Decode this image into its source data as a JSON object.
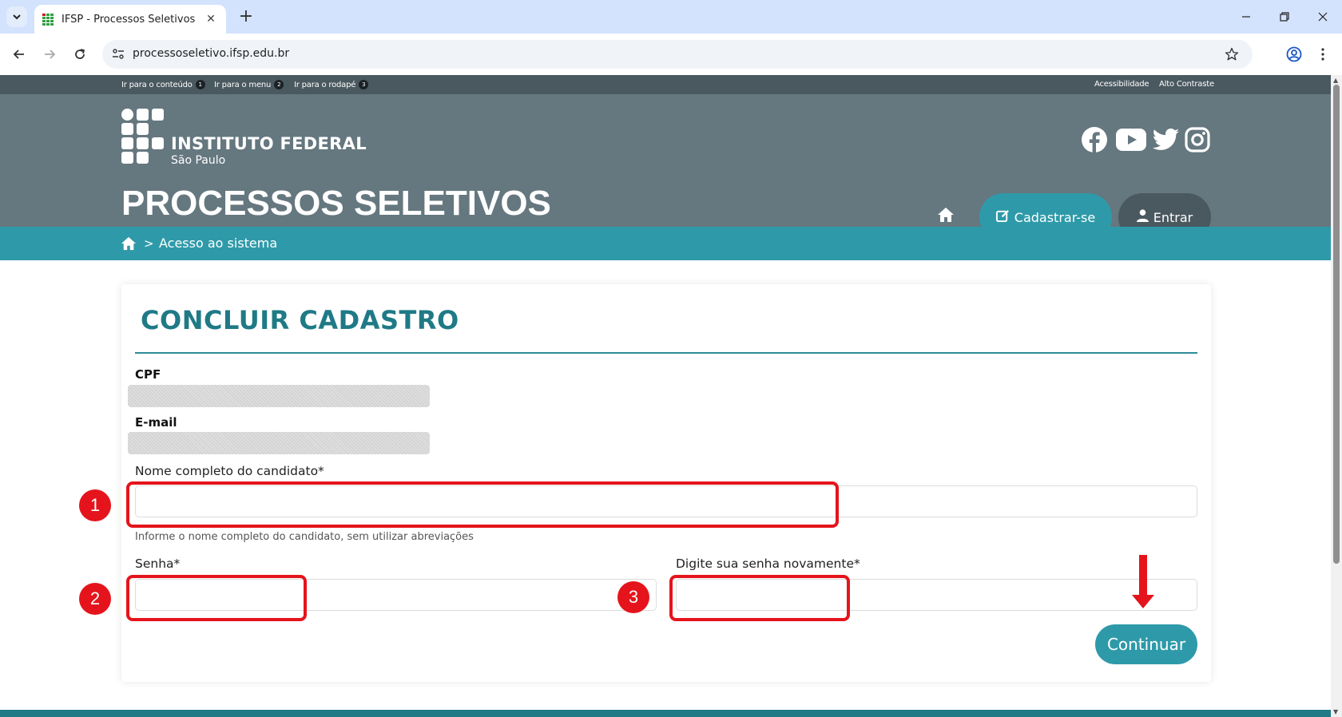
{
  "browser": {
    "tab_title": "IFSP - Processos Seletivos",
    "new_tab_icon": "plus-icon",
    "url": "processoseletivo.ifsp.edu.br",
    "window_controls": [
      "minimize",
      "restore",
      "close"
    ]
  },
  "accessibility_bar": {
    "skip_links": [
      {
        "label": "Ir para o conteúdo",
        "key": "1"
      },
      {
        "label": "Ir para o menu",
        "key": "2"
      },
      {
        "label": "Ir para o rodapé",
        "key": "3"
      }
    ],
    "right_links": [
      "Acessibilidade",
      "Alto Contraste"
    ]
  },
  "header": {
    "logo_title": "INSTITUTO FEDERAL",
    "logo_subtitle": "São Paulo",
    "site_title": "PROCESSOS SELETIVOS",
    "social_icons": [
      "facebook-icon",
      "youtube-icon",
      "twitter-icon",
      "instagram-icon"
    ],
    "register_label": "Cadastrar-se",
    "login_label": "Entrar"
  },
  "breadcrumb": {
    "separator": ">",
    "current": "Acesso ao sistema"
  },
  "form": {
    "title": "CONCLUIR CADASTRO",
    "cpf_label": "CPF",
    "email_label": "E-mail",
    "name_label": "Nome completo do candidato*",
    "name_value": "",
    "name_hint": "Informe o nome completo do candidato, sem utilizar abreviações",
    "password_label": "Senha*",
    "password_value": "",
    "confirm_label": "Digite sua senha novamente*",
    "confirm_value": "",
    "submit_label": "Continuar"
  },
  "annotations": {
    "markers": [
      "1",
      "2",
      "3"
    ],
    "color": "#e5141c"
  },
  "colors": {
    "header_bg": "#65777f",
    "access_bar_bg": "#4a5960",
    "accent": "#2e9aa9",
    "title": "#1f7a86"
  }
}
